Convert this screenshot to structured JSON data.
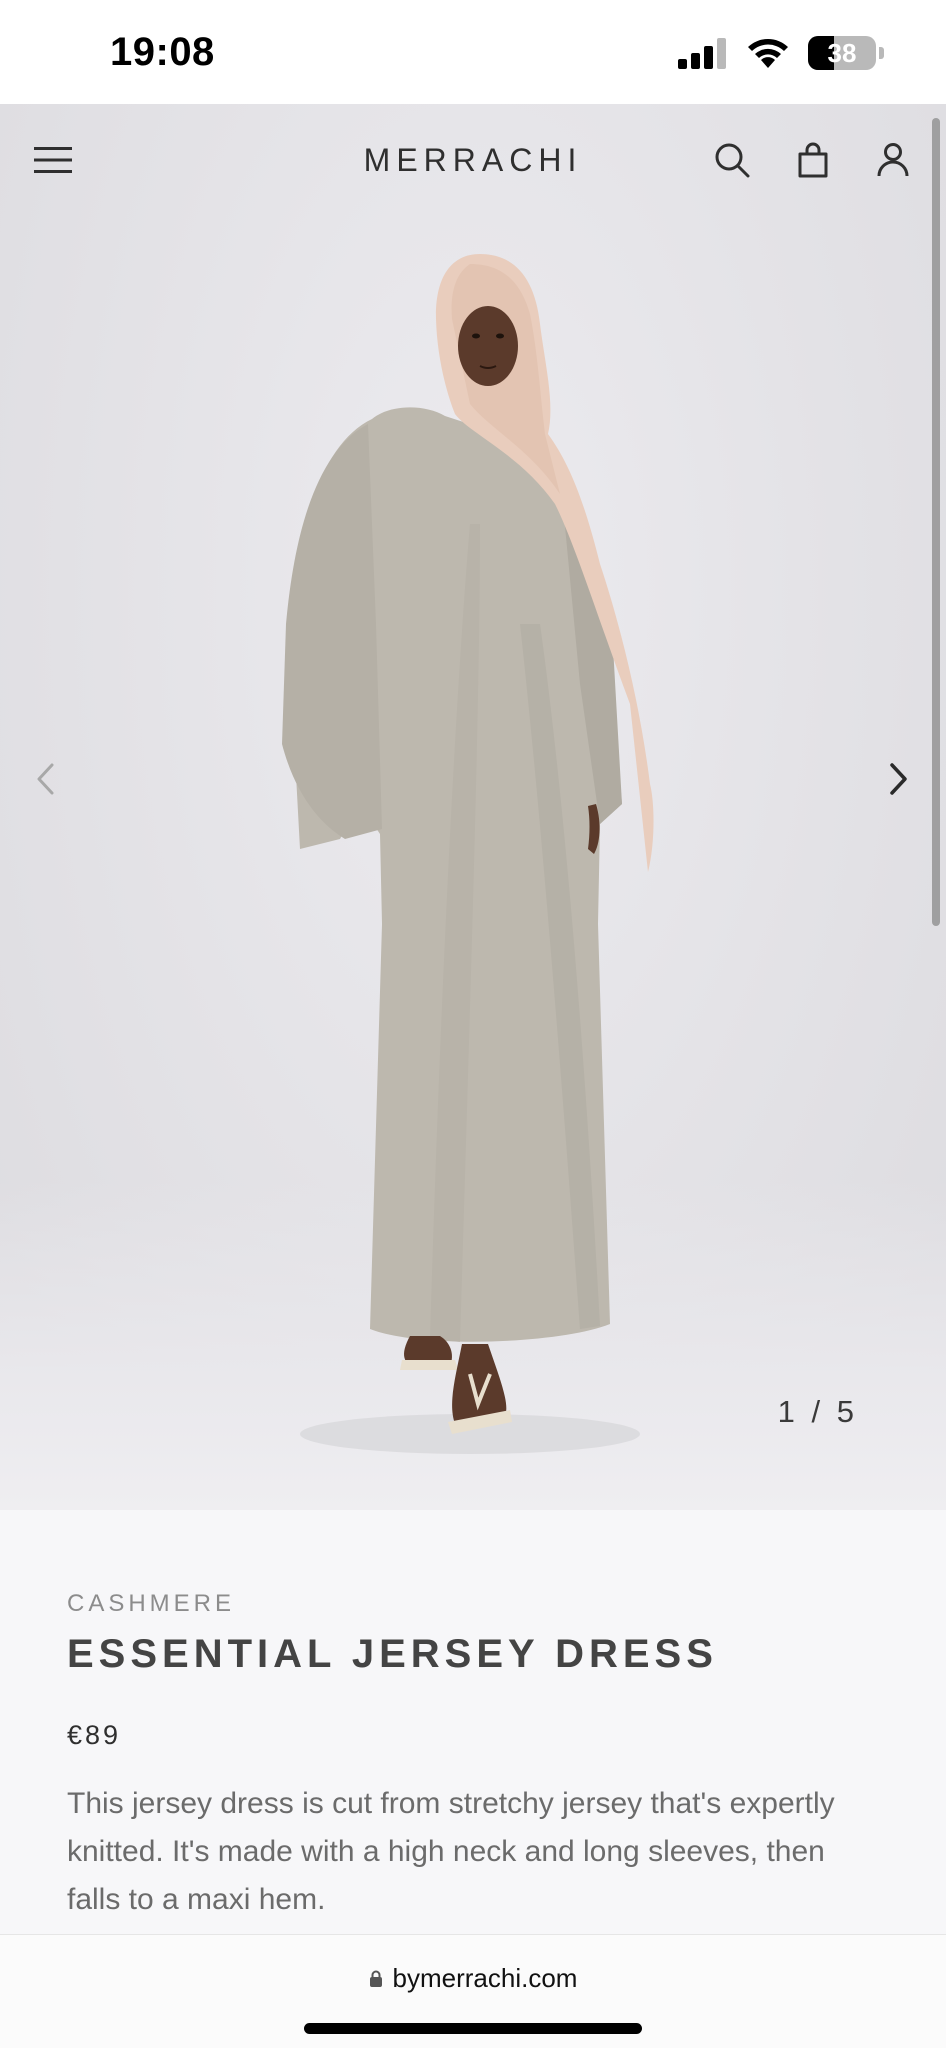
{
  "status_bar": {
    "time": "19:08",
    "battery_level": "38",
    "icons": [
      "cellular-signal-icon",
      "wifi-icon",
      "battery-icon"
    ]
  },
  "header": {
    "logo": "MERRACHI",
    "icons": [
      "menu-icon",
      "search-icon",
      "shopping-bag-icon",
      "account-icon"
    ]
  },
  "gallery": {
    "counter": "1 / 5",
    "current": 1,
    "total": 5
  },
  "product": {
    "collection": "CASHMERE",
    "title": "ESSENTIAL JERSEY DRESS",
    "price": "€89",
    "description": "This jersey dress is cut from stretchy jersey that's expertly knitted. It's made with a high neck and long sleeves, then falls to a maxi hem."
  },
  "browser": {
    "url": "bymerrachi.com"
  },
  "colors": {
    "dress": "#bdb8ae",
    "hijab": "#e9cdbd",
    "background": "#e3e2e6",
    "product_panel": "#f7f7f9"
  }
}
